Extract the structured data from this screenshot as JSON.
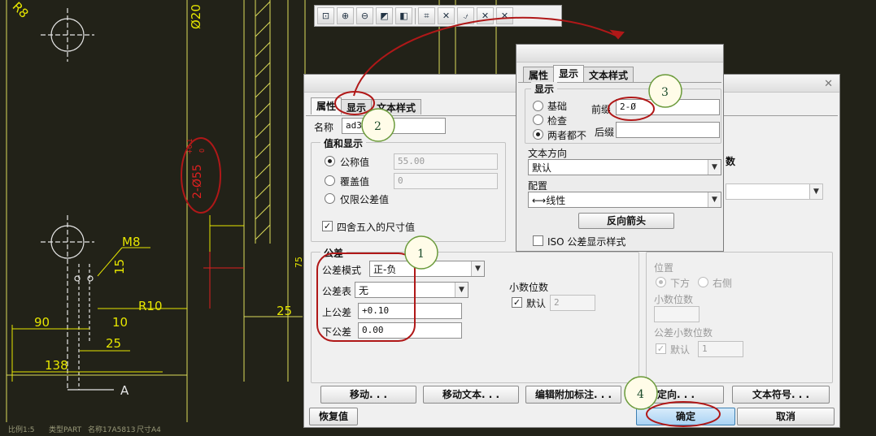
{
  "toolbar": {
    "icons": [
      "zoom-fit-icon",
      "zoom-in-icon",
      "zoom-out-icon",
      "repaint-icon",
      "view-3d-icon",
      "annotation-icon",
      "datum-plane-icon",
      "datum-axis-icon",
      "datum-point-icon",
      "coord-sys-icon"
    ]
  },
  "cad": {
    "labels": {
      "r8": "R8",
      "d20": "Ø20",
      "m8": "M8",
      "d15": "15",
      "r10": "R10",
      "d90": "90",
      "d10": "10",
      "d25a": "25",
      "d25b": "25",
      "d138": "138",
      "a": "A",
      "d75": "75",
      "highlight_dim": "2-Ø55",
      "highlight_tol_top": "+0.1",
      "highlight_tol_bottom": "0"
    },
    "status": {
      "scale": "比例1:5",
      "type": "类型PART",
      "name": "名称17A5813",
      "size": "尺寸A4"
    }
  },
  "main_dialog": {
    "tabs": [
      "属性",
      "显示",
      "文本样式"
    ],
    "name_label": "名称",
    "name_value": "ad3",
    "value_group": {
      "title": "值和显示",
      "nominal_label": "公称值",
      "nominal_value": "55.00",
      "override_label": "覆盖值",
      "override_value": "0",
      "tolerance_only_label": "仅限公差值",
      "round_label": "四舍五入的尺寸值"
    },
    "tolerance_group": {
      "title": "公差",
      "mode_label": "公差模式",
      "mode_value": "正-负",
      "table_label": "公差表",
      "table_value": "无",
      "upper_label": "上公差",
      "upper_value": "+0.10",
      "lower_label": "下公差",
      "lower_value": "0.00",
      "decimals_title": "小数位数",
      "default_label": "默认",
      "default_value": "2"
    },
    "right_panel": {
      "number_label": "数",
      "position_label": "位置",
      "below_label": "下方",
      "right_label": "右侧",
      "decimals_label": "小数位数",
      "tol_decimals_label": "公差小数位数",
      "default_label": "默认",
      "default_value": "1"
    },
    "buttons": {
      "move": "移动. . .",
      "move_text": "移动文本. . .",
      "edit_attached": "编辑附加标注. . .",
      "orient": "定向. . .",
      "text_symbol": "文本符号. . .",
      "restore": "恢复值",
      "ok": "确定",
      "cancel": "取消"
    }
  },
  "front_dialog": {
    "tabs": [
      "属性",
      "显示",
      "文本样式"
    ],
    "display_group": "显示",
    "radio_basic": "基础",
    "radio_inspect": "检查",
    "radio_neither": "两者都不",
    "prefix_label": "前缀",
    "prefix_value": "2-Ø",
    "suffix_label": "后缀",
    "suffix_value": "",
    "text_dir_label": "文本方向",
    "text_dir_value": "默认",
    "config_label": "配置",
    "config_value": "⟷线性",
    "flip_arrows": "反向箭头",
    "iso_label": "ISO 公差显示样式"
  },
  "annotations": {
    "n1": "1",
    "n2": "2",
    "n3": "3",
    "n4": "4"
  },
  "colors": {
    "cad_bg": "#222218",
    "cad_line": "#e6e600",
    "annotation": "#b01818"
  }
}
